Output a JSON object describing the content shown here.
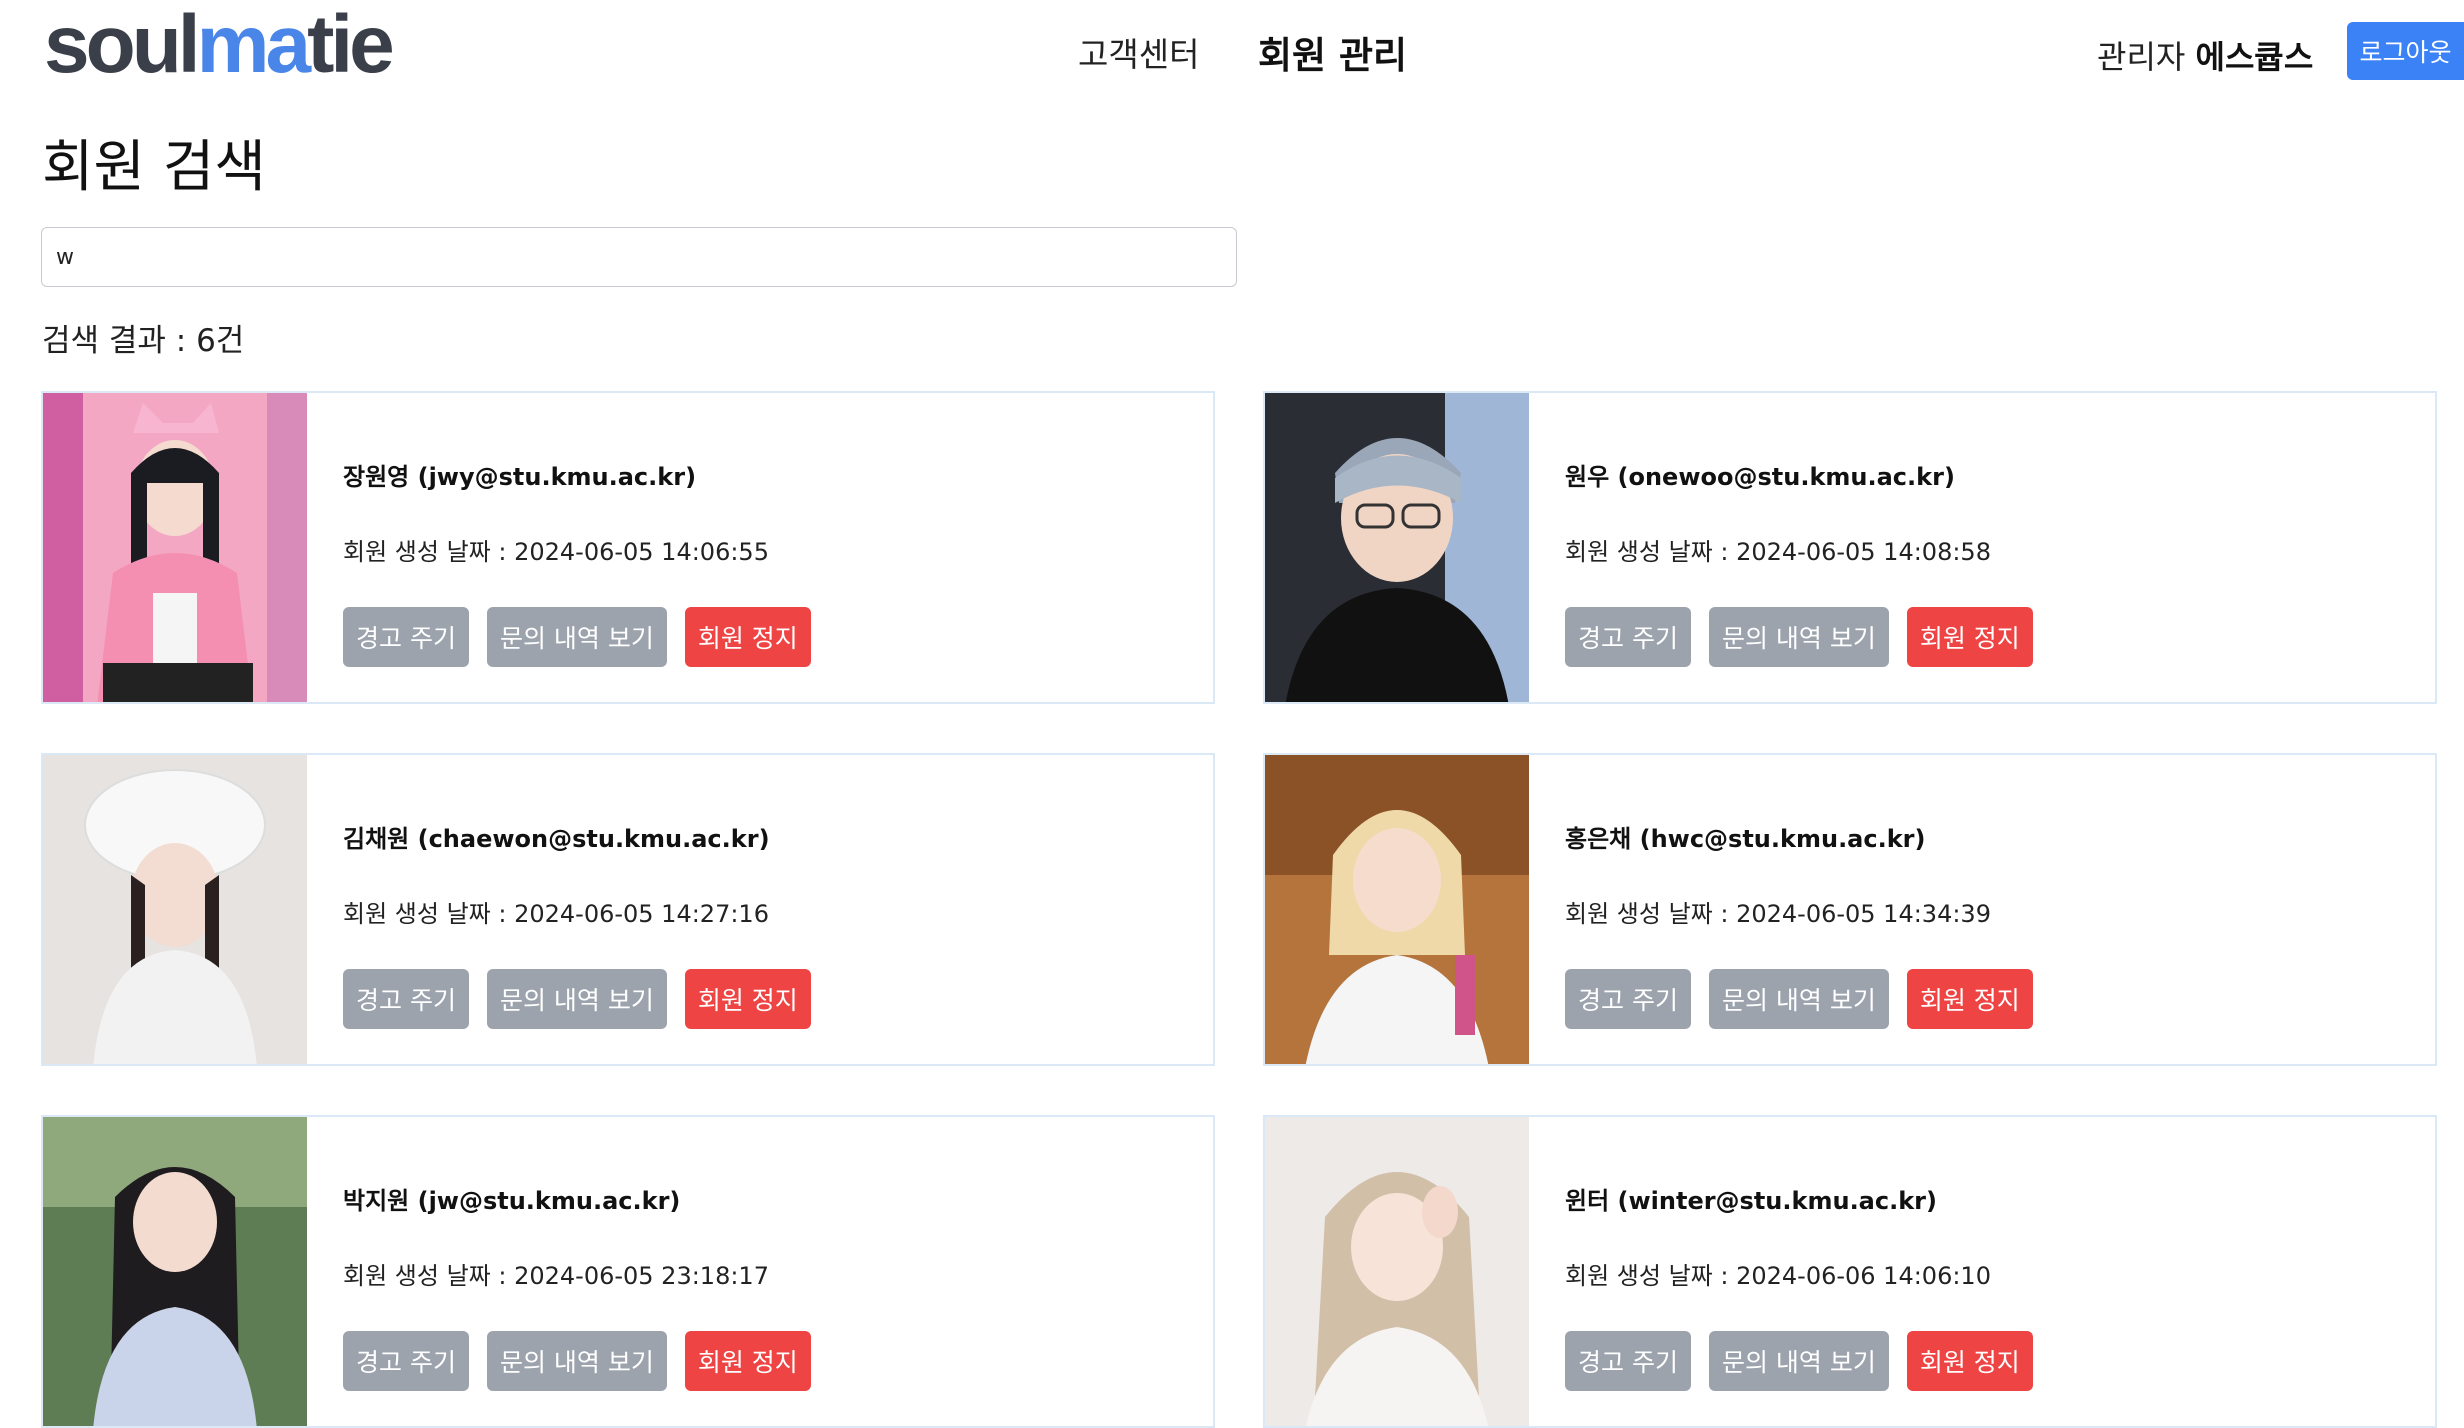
{
  "nav": {
    "logo_text_a": "soul",
    "logo_text_b": "ma",
    "logo_text_c": "tie",
    "customer_center": "고객센터",
    "member_management": "회원 관리",
    "admin_prefix": "관리자",
    "admin_name": "에스큡스",
    "logout": "로그아웃"
  },
  "page_title": "회원 검색",
  "search": {
    "value": "w"
  },
  "result_text": "검색 결과 : 6건",
  "colors": {
    "accent": "#3b82f6",
    "button_grey": "#9ca3ad",
    "button_red": "#ef4444",
    "card_border": "#dbe8f6"
  },
  "members": [
    {
      "name": "장원영 (jwy@stu.kmu.ac.kr)",
      "created": "회원 생성 날짜 : 2024-06-05 14:06:55",
      "warn": "경고 주기",
      "inquiry": "문의 내역 보기",
      "suspend": "회원 정지"
    },
    {
      "name": "원우 (onewoo@stu.kmu.ac.kr)",
      "created": "회원 생성 날짜 : 2024-06-05 14:08:58",
      "warn": "경고 주기",
      "inquiry": "문의 내역 보기",
      "suspend": "회원 정지"
    },
    {
      "name": "김채원 (chaewon@stu.kmu.ac.kr)",
      "created": "회원 생성 날짜 : 2024-06-05 14:27:16",
      "warn": "경고 주기",
      "inquiry": "문의 내역 보기",
      "suspend": "회원 정지"
    },
    {
      "name": "홍은채 (hwc@stu.kmu.ac.kr)",
      "created": "회원 생성 날짜 : 2024-06-05 14:34:39",
      "warn": "경고 주기",
      "inquiry": "문의 내역 보기",
      "suspend": "회원 정지"
    },
    {
      "name": "박지원 (jw@stu.kmu.ac.kr)",
      "created": "회원 생성 날짜 : 2024-06-05 23:18:17",
      "warn": "경고 주기",
      "inquiry": "문의 내역 보기",
      "suspend": "회원 정지"
    },
    {
      "name": "윈터 (winter@stu.kmu.ac.kr)",
      "created": "회원 생성 날짜 : 2024-06-06 14:06:10",
      "warn": "경고 주기",
      "inquiry": "문의 내역 보기",
      "suspend": "회원 정지"
    }
  ]
}
